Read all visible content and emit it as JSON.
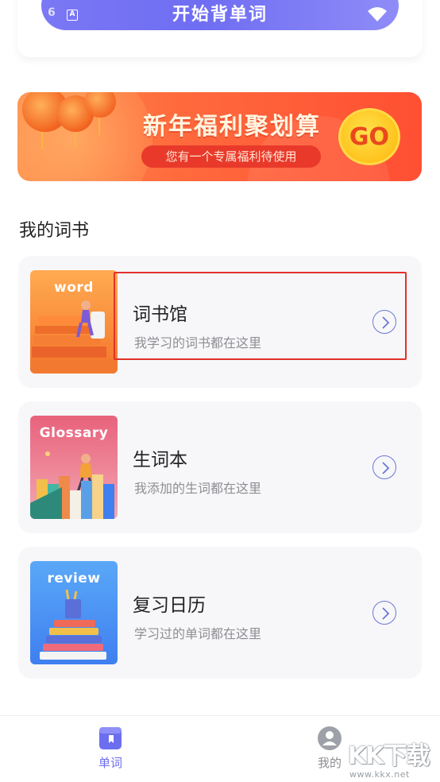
{
  "top_card": {
    "start_button_label": "开始背单词",
    "left_number": "6",
    "left_icon_glyph": "A"
  },
  "banner": {
    "title": "新年福利聚划算",
    "subtitle": "您有一个专属福利待使用",
    "go_label": "GO"
  },
  "section": {
    "title": "我的词书"
  },
  "books": [
    {
      "cover_label": "word",
      "title": "词书馆",
      "subtitle": "我学习的词书都在这里",
      "cover_colors": [
        "#ffa24a",
        "#f4752a"
      ]
    },
    {
      "cover_label": "Glossary",
      "title": "生词本",
      "subtitle": "我添加的生词都在这里",
      "cover_colors": [
        "#f4a3ae",
        "#e8627c"
      ]
    },
    {
      "cover_label": "review",
      "title": "复习日历",
      "subtitle": "学习过的单词都在这里",
      "cover_colors": [
        "#5aa8f8",
        "#3f7ff0"
      ]
    }
  ],
  "bottom_nav": {
    "items": [
      {
        "label": "单词",
        "active": true
      },
      {
        "label": "我的",
        "active": false
      }
    ]
  },
  "watermark": {
    "big": "KK下载",
    "small": "www.kkx.net"
  },
  "colors": {
    "accent": "#6c6ef0",
    "highlight": "#e2312a",
    "banner": "#ff5a36"
  }
}
